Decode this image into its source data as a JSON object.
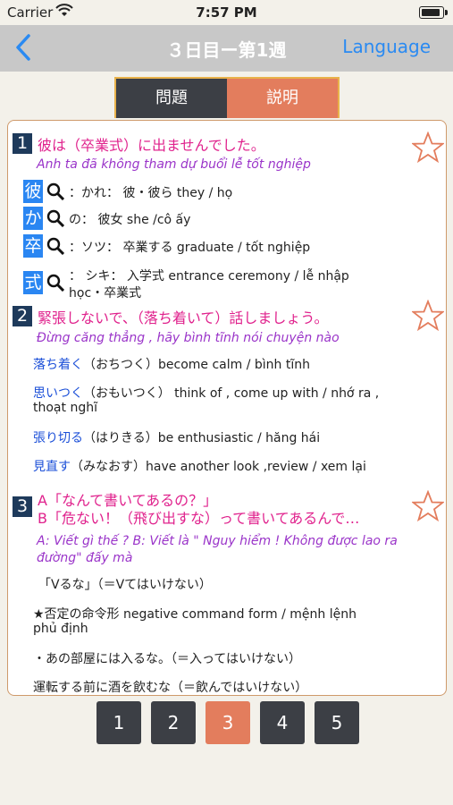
{
  "status": {
    "carrier": "Carrier",
    "time": "7:57 PM"
  },
  "nav": {
    "title": "３日目ー第1週",
    "language": "Language"
  },
  "tabs": {
    "question": "問題",
    "explanation": "説明"
  },
  "items": [
    {
      "number": "1",
      "japanese": "彼は（卒業式）に出ませんでした。",
      "vietnamese": "Anh ta đã không tham dự buổi lễ tốt nghiệp",
      "kanji": [
        {
          "char": "彼",
          "text": "：かれ：  彼・彼ら    they / họ"
        },
        {
          "char": "か",
          "text": "の：  彼女    she /cô ấy"
        },
        {
          "char": "卒",
          "text": "：ソツ：  卒業する    graduate / tốt nghiệp"
        },
        {
          "char": "式",
          "text": "：  シキ：  入学式    entrance ceremony / lễ nhập",
          "text2": "học・卒業式"
        }
      ]
    },
    {
      "number": "2",
      "japanese": "緊張しないで、（落ち着いて）話しましょう。",
      "vietnamese": "Đừng căng thẳng , hãy bình tĩnh nói chuyện nào",
      "vocab": [
        {
          "word": "落ち着く",
          "rest": "（おちつく）become calm / bình tĩnh"
        },
        {
          "word": "思いつく",
          "rest": "（おもいつく）  think of , come up with / nhớ ra ,",
          "rest2": "thoạt nghĩ"
        },
        {
          "word": "張り切る",
          "rest": "（はりきる）be enthusiastic / hăng hái"
        },
        {
          "word": "見直す",
          "rest": "（みなおす）have another look ,review / xem lại"
        }
      ]
    },
    {
      "number": "3",
      "japanese_a": "A「なんて書いてあるの？」",
      "japanese_b": "B「危ない！（飛び出すな）って書いてあるんで…",
      "vietnamese_1": "A: Viết gì thế ?       B: Viết là \" Nguy hiểm ! Không được lao ra",
      "vietnamese_2": "đường\" đấy mà",
      "grammar": "「Vるな」（＝Vてはいけない）",
      "note_1": "★否定の命令形      negative command form / mệnh lệnh",
      "note_2": "phủ định",
      "example_1": "・あの部屋には入るな。（＝入ってはいけない）",
      "example_2": "運転する前に酒を飲むな（＝飲んではいけない）"
    }
  ],
  "pager": {
    "pages": [
      "1",
      "2",
      "3",
      "4",
      "5"
    ],
    "active": "3"
  },
  "colors": {
    "accent": "#e37d5d",
    "dark": "#3c3f45",
    "link": "#2a8af2",
    "pink": "#e0228d",
    "purple": "#9a34c9"
  }
}
